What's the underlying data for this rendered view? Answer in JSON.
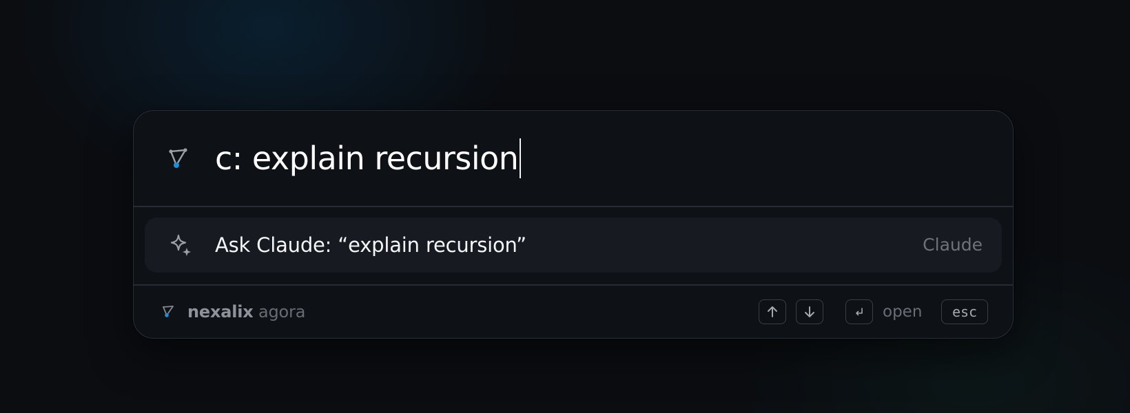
{
  "search": {
    "query": "c: explain recursion",
    "icon": "triangle-nodes-icon"
  },
  "results": [
    {
      "label": "Ask Claude: “explain recursion”",
      "source": "Claude",
      "icon": "sparkle-icon",
      "selected": true
    }
  ],
  "footer": {
    "brand_name": "nexalix",
    "brand_sub": "agora",
    "keys": {
      "up": "arrow-up-icon",
      "down": "arrow-down-icon",
      "enter": "enter-icon",
      "esc": "esc"
    },
    "open_label": "open"
  },
  "colors": {
    "background": "#0b0d11",
    "panel": "#0e1116",
    "selected_row": "#171a21",
    "accent": "#1f8fd6",
    "border": "#2b2f37"
  }
}
